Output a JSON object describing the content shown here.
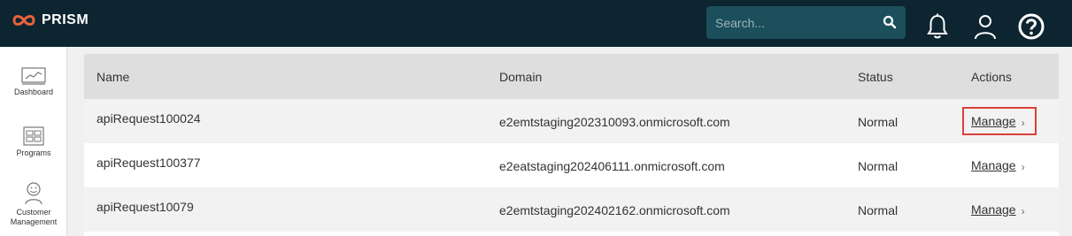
{
  "brand": {
    "name": "PRISM",
    "logo_icon": "infinity-icon",
    "accent": "#e8623a"
  },
  "header": {
    "search_placeholder": "Search...",
    "icons": [
      "search-icon",
      "bell-icon",
      "user-icon",
      "help-icon"
    ]
  },
  "sidebar": {
    "items": [
      {
        "label": "Dashboard",
        "icon": "chart-icon"
      },
      {
        "label": "Programs",
        "icon": "grid-icon"
      },
      {
        "label": "Customer Management",
        "label_line1": "Customer",
        "label_line2": "Management",
        "icon": "smiley-icon"
      }
    ]
  },
  "table": {
    "columns": [
      "Name",
      "Domain",
      "Status",
      "Actions"
    ],
    "rows": [
      {
        "name": "apiRequest100024",
        "domain": "e2emtstaging202310093.onmicrosoft.com",
        "status": "Normal",
        "action": "Manage",
        "highlighted": true
      },
      {
        "name": "apiRequest100377",
        "domain": "e2eatstaging202406111.onmicrosoft.com",
        "status": "Normal",
        "action": "Manage",
        "highlighted": false
      },
      {
        "name": "apiRequest10079",
        "domain": "e2emtstaging202402162.onmicrosoft.com",
        "status": "Normal",
        "action": "Manage",
        "highlighted": false
      }
    ]
  },
  "colors": {
    "topbar": "#0c2530",
    "search_bg": "#1b4f5c",
    "highlight_border": "#d9403a"
  }
}
